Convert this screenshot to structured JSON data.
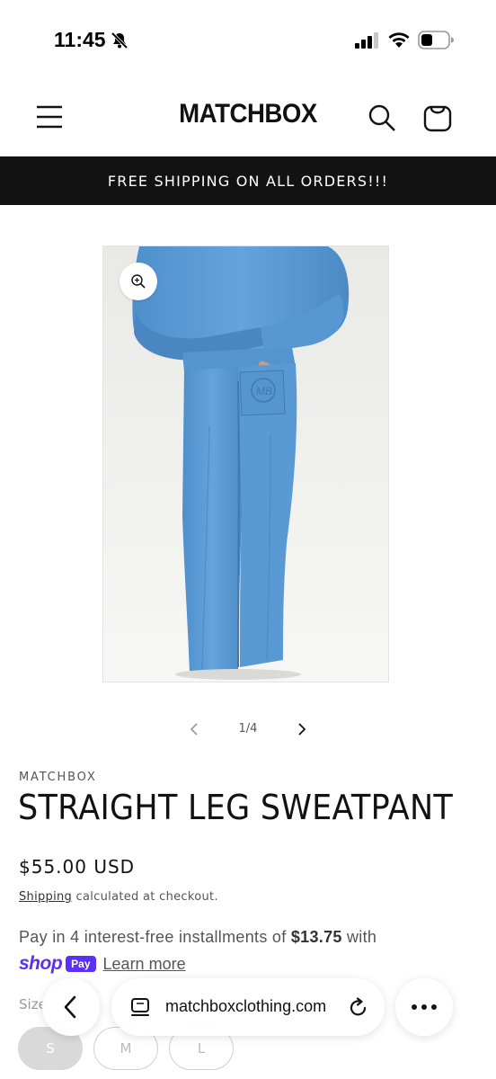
{
  "status_bar": {
    "time": "11:45",
    "icons": [
      "bell-slash-icon",
      "cellular-signal-icon",
      "wifi-icon",
      "battery-icon"
    ]
  },
  "header": {
    "logo": "MATCHBOX",
    "icons": [
      "hamburger-menu-icon",
      "search-icon",
      "cart-bag-icon"
    ]
  },
  "announcement": {
    "text": "FREE SHIPPING ON ALL ORDERS!!!"
  },
  "gallery": {
    "counter": "1/4",
    "icons": [
      "zoom-in-icon",
      "chevron-left-icon",
      "chevron-right-icon"
    ]
  },
  "product": {
    "vendor": "MATCHBOX",
    "title": "STRAIGHT LEG SWEATPANT",
    "price": "$55.00 USD",
    "shipping_link": "Shipping",
    "shipping_suffix": " calculated at checkout.",
    "installments_prefix": "Pay in 4 interest-free installments of ",
    "installments_amount": "$13.75",
    "installments_suffix": " with",
    "shoppay_shop": "shop",
    "shoppay_pay": "Pay",
    "learn_more": "Learn more",
    "size_label": "Size",
    "sizes": [
      "S",
      "M",
      "L"
    ],
    "selected_size": "S",
    "pocket_logo": "MB"
  },
  "browser": {
    "url": "matchboxclothing.com",
    "icons": [
      "back-arrow-icon",
      "tabs-icon",
      "reload-icon",
      "more-icon"
    ]
  },
  "colors": {
    "announcement_bg": "#121212",
    "garment_blue": "#5b9bd5",
    "shoppay_purple": "#5a31f4"
  }
}
